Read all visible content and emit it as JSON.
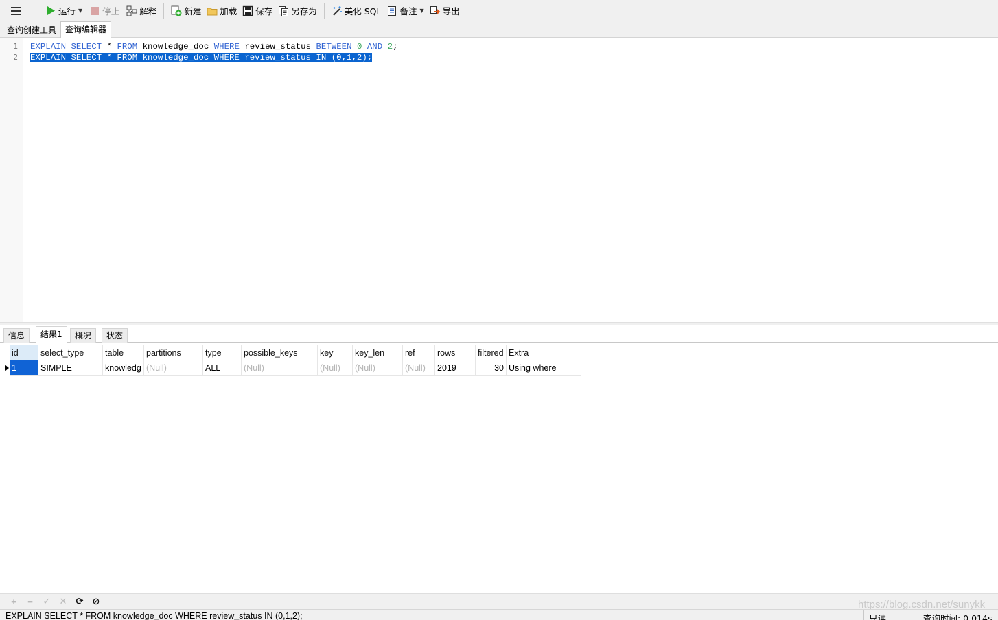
{
  "toolbar": {
    "run": "运行",
    "stop": "停止",
    "explain": "解释",
    "new": "新建",
    "load": "加载",
    "save": "保存",
    "save_as": "另存为",
    "beautify": "美化 SQL",
    "note": "备注",
    "export": "导出"
  },
  "query_tabs": [
    "查询创建工具",
    "查询编辑器"
  ],
  "editor": {
    "line_numbers": [
      "1",
      "2"
    ],
    "line1": {
      "t1": "EXPLAIN",
      "t2": " ",
      "t3": "SELECT",
      "t4": " * ",
      "t5": "FROM",
      "t6": " knowledge_doc ",
      "t7": "WHERE",
      "t8": " review_status ",
      "t9": "BETWEEN",
      "t10": " ",
      "t11": "0",
      "t12": " ",
      "t13": "AND",
      "t14": " ",
      "t15": "2",
      "t16": ";"
    },
    "line2": "EXPLAIN SELECT * FROM knowledge_doc WHERE review_status IN (0,1,2);"
  },
  "result_tabs": [
    "信息",
    "结果1",
    "概况",
    "状态"
  ],
  "grid": {
    "columns": [
      "id",
      "select_type",
      "table",
      "partitions",
      "type",
      "possible_keys",
      "key",
      "key_len",
      "ref",
      "rows",
      "filtered",
      "Extra"
    ],
    "rows": [
      {
        "id": "1",
        "select_type": "SIMPLE",
        "table": "knowledg",
        "partitions": "(Null)",
        "type": "ALL",
        "possible_keys": "(Null)",
        "key": "(Null)",
        "key_len": "(Null)",
        "ref": "(Null)",
        "rows": "2019",
        "filtered": "30",
        "extra": "Using where"
      }
    ]
  },
  "nav": {
    "add": "+",
    "remove": "−",
    "apply": "✓",
    "discard": "✕",
    "refresh": "⟳",
    "stop": "⊘"
  },
  "status": {
    "sql": "EXPLAIN SELECT * FROM knowledge_doc WHERE review_status IN (0,1,2);",
    "readonly": "只读",
    "query_time": "查询时间: 0.014s"
  },
  "watermark": "https://blog.csdn.net/sunykk",
  "colors": {
    "keyword": "#3264d2",
    "number": "#3fa860",
    "selection": "#0a64d0",
    "run_icon": "#2fae2f"
  }
}
